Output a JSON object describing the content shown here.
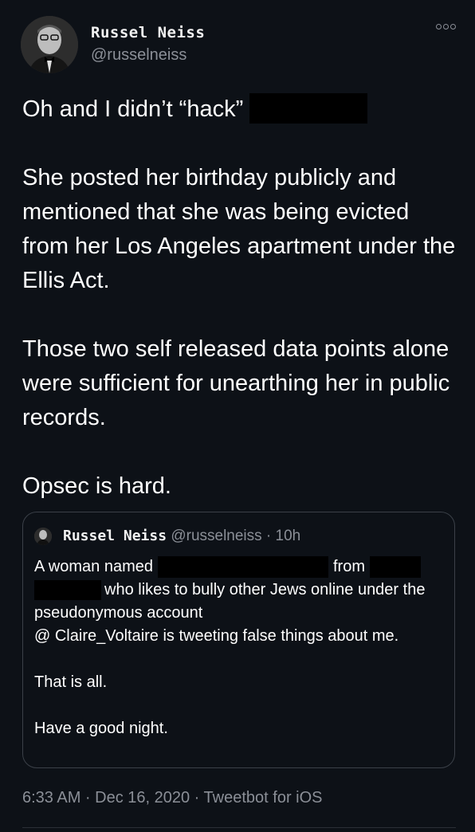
{
  "tweet": {
    "author": {
      "display_name": "Russel Neiss",
      "handle": "@russelneiss"
    },
    "more_icon": "more-dots-icon",
    "lines": {
      "l1": "Oh and I didn’t “hack”",
      "l2": "She posted her birthday publicly and mentioned that she was being evicted from her Los Angeles apartment under the Ellis Act.",
      "l3": "Those two self released data points alone were sufficient for unearthing her in public records.",
      "l4": "Opsec is hard."
    },
    "quoted": {
      "display_name": "Russel Neiss",
      "meta": "@russelneiss · 10h",
      "p1a": "A woman named",
      "p1b": "from",
      "p1c": "who likes to bully other Jews online under the pseudonymous  account",
      "p1d": "@ Claire_Voltaire is tweeting false things about me.",
      "p2": "That is all.",
      "p3": "Have a good night."
    },
    "footer": "6:33 AM · Dec 16, 2020 · Tweetbot for iOS"
  },
  "colors": {
    "background": "#0d1117",
    "text": "#ffffff",
    "muted": "#8b8f97",
    "border": "#3b4048"
  }
}
